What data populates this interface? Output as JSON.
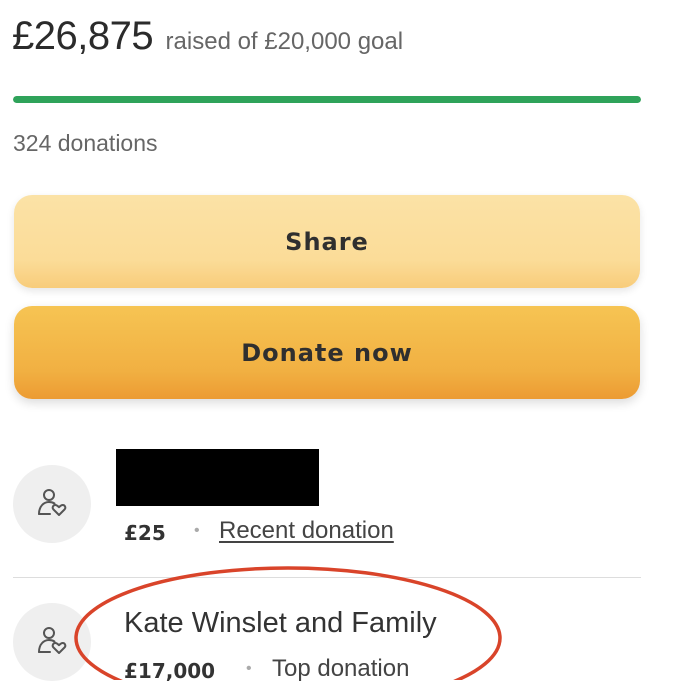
{
  "fundraiser": {
    "raised": "£26,875",
    "goal_text": "raised of £20,000 goal",
    "progress_fraction": 1.0,
    "donation_count": "324 donations"
  },
  "actions": {
    "share_label": "Share",
    "donate_label": "Donate now"
  },
  "donations": [
    {
      "name": "",
      "amount": "£25",
      "separator": "•",
      "kind": "Recent donation"
    },
    {
      "name": "Kate Winslet and Family",
      "amount": "£17,000",
      "separator": "•",
      "kind": "Top donation"
    }
  ],
  "colors": {
    "progress": "#2fa35a",
    "share_button": "#fbdc98",
    "donate_button": "#f1b042",
    "annotation_circle": "#d9442a"
  },
  "icons": {
    "donor_avatar": "person-heart-icon"
  }
}
